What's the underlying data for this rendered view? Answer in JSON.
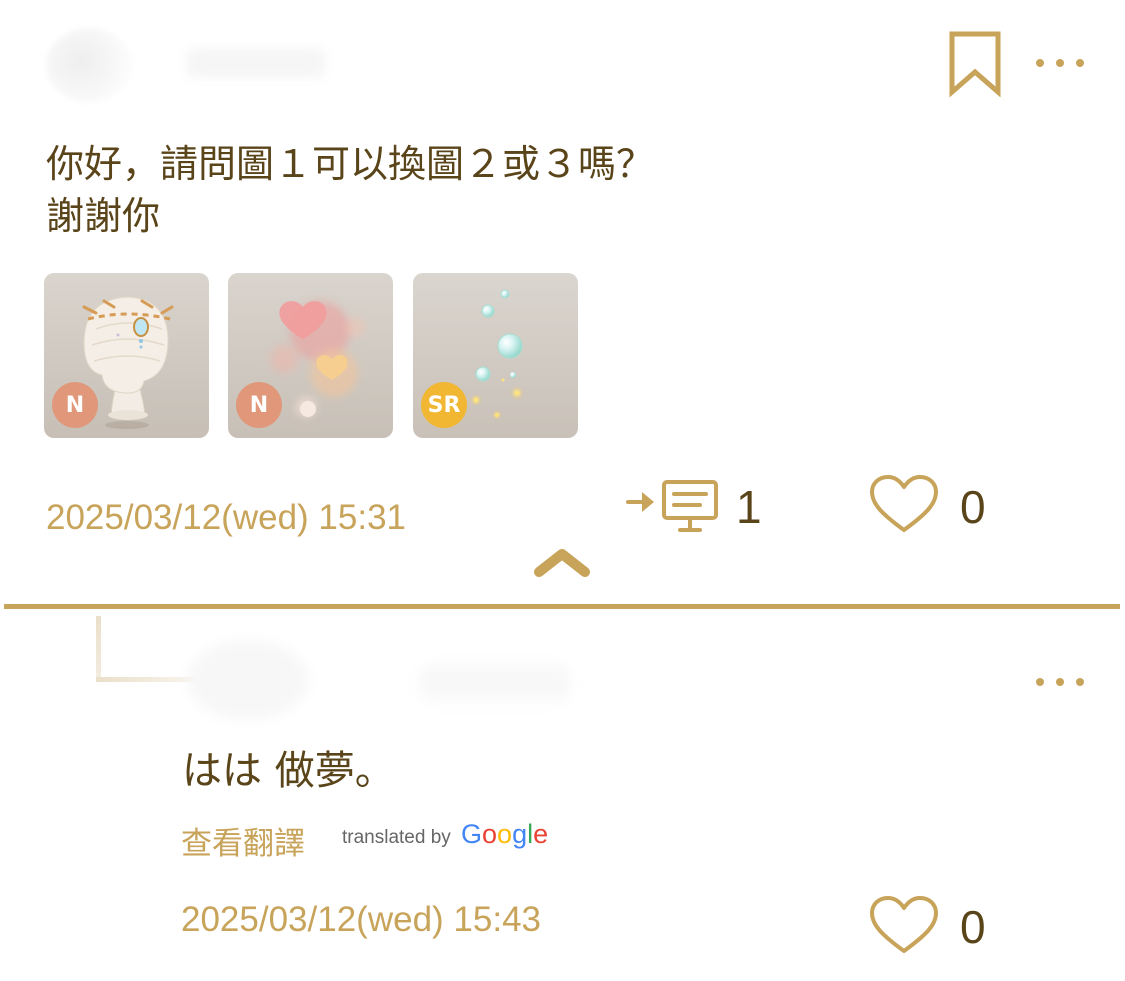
{
  "post": {
    "text": "你好，請問圖１可以換圖２或３嗎？\n謝謝你",
    "timestamp": "2025/03/12(wed) 15:31",
    "reply_count": "1",
    "like_count": "0",
    "icons": {
      "bookmark": "bookmark-icon",
      "more": "more-options-icon",
      "reply": "reply-count-icon",
      "like": "heart-icon",
      "collapse": "chevron-up-icon"
    },
    "items": [
      {
        "rarity": "N",
        "badge_color": "#e0977a",
        "subject": "head-accessory"
      },
      {
        "rarity": "N",
        "badge_color": "#e0977a",
        "subject": "floating-hearts"
      },
      {
        "rarity": "SR",
        "badge_color": "#f1b733",
        "subject": "bubbles-sparkles"
      }
    ]
  },
  "reply": {
    "text": "はは 做夢。",
    "translate_link": "查看翻譯",
    "translated_by": "translated by",
    "google_letters": [
      "G",
      "o",
      "o",
      "g",
      "l",
      "e"
    ],
    "google_colors": [
      "#4285F4",
      "#EA4335",
      "#FBBC05",
      "#4285F4",
      "#34A853",
      "#EA4335"
    ],
    "timestamp": "2025/03/12(wed) 15:43",
    "like_count": "0"
  },
  "colors": {
    "accent": "#c8a35a",
    "text_dark": "#5a4419"
  }
}
